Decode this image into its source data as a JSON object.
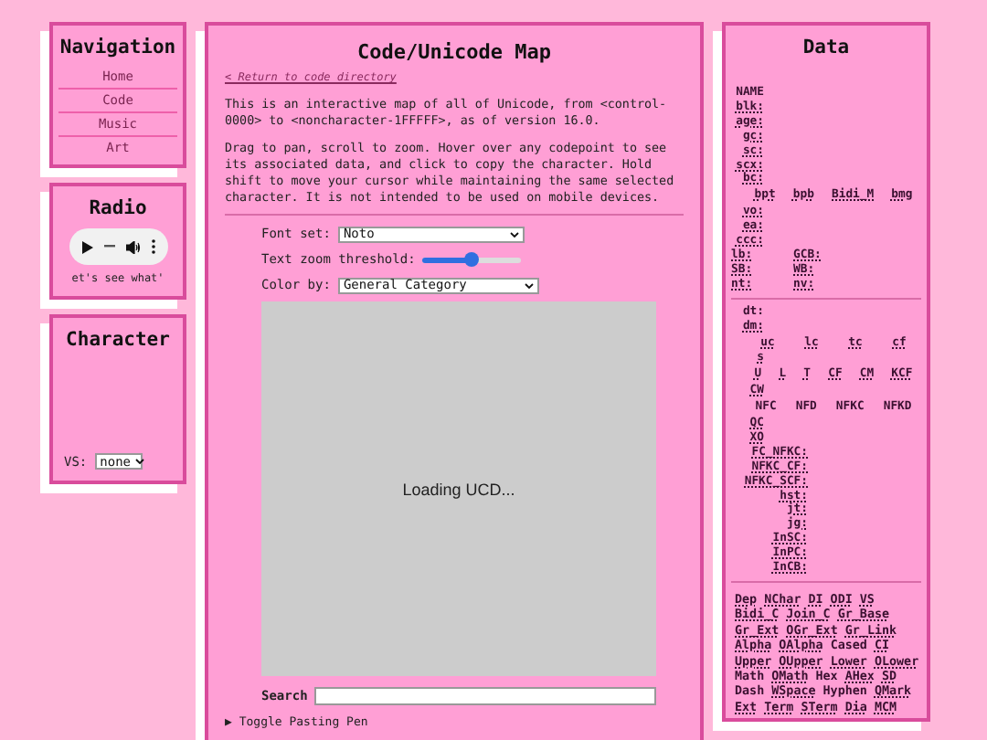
{
  "nav": {
    "title": "Navigation",
    "items": [
      {
        "label": "Home"
      },
      {
        "label": "Code"
      },
      {
        "label": "Music"
      },
      {
        "label": "Art"
      }
    ]
  },
  "radio": {
    "title": "Radio",
    "ticker": "et's see what'"
  },
  "character": {
    "title": "Character",
    "vs_label": "VS:",
    "vs_value": "none"
  },
  "main": {
    "title": "Code/Unicode Map",
    "back_link": "< Return to code directory",
    "paragraphs": [
      "This is an interactive map of all of Unicode, from <control-0000> to <noncharacter-1FFFFF>, as of version 16.0.",
      "Drag to pan, scroll to zoom. Hover over any codepoint to see its associated data, and click to copy the character. Hold shift to move your cursor while maintaining the same selected character. It is not intended to be used on mobile devices."
    ],
    "font_set": {
      "label": "Font set:",
      "value": "Noto"
    },
    "zoom": {
      "label": "Text zoom threshold:",
      "level": 0.5
    },
    "color_by": {
      "label": "Color by:",
      "value": "General Category"
    },
    "canvas_message": "Loading UCD...",
    "search": {
      "label": "Search"
    },
    "toggle": "▶ Toggle Pasting Pen"
  },
  "data": {
    "title": "Data",
    "rows": [
      {
        "kind": "field",
        "items": [
          {
            "text": "NAME",
            "abbr": false
          }
        ]
      },
      {
        "kind": "field",
        "items": [
          {
            "text": "blk:",
            "abbr": true
          }
        ]
      },
      {
        "kind": "field",
        "items": [
          {
            "text": "age:",
            "abbr": true
          }
        ]
      },
      {
        "kind": "field",
        "items": [
          {
            "text": "gc:",
            "abbr": true
          }
        ]
      },
      {
        "kind": "field",
        "items": [
          {
            "text": "sc:",
            "abbr": true
          }
        ]
      },
      {
        "kind": "field",
        "items": [
          {
            "text": "scx:",
            "abbr": true
          }
        ]
      },
      {
        "kind": "field",
        "items": [
          {
            "text": "bc:",
            "abbr": true
          }
        ]
      },
      {
        "kind": "heads",
        "items": [
          {
            "text": "bpt",
            "abbr": true
          },
          {
            "text": "bpb",
            "abbr": true
          },
          {
            "text": "Bidi_M",
            "abbr": true
          },
          {
            "text": "bmg",
            "abbr": true
          }
        ]
      },
      {
        "kind": "field",
        "items": [
          {
            "text": "vo:",
            "abbr": true
          }
        ]
      },
      {
        "kind": "field",
        "items": [
          {
            "text": "ea:",
            "abbr": true
          }
        ]
      },
      {
        "kind": "field",
        "items": [
          {
            "text": "ccc:",
            "abbr": true
          }
        ]
      },
      {
        "kind": "pair",
        "items": [
          {
            "text": "lb:",
            "abbr": true
          },
          {
            "text": "GCB:",
            "abbr": true
          }
        ]
      },
      {
        "kind": "pair",
        "items": [
          {
            "text": "SB:",
            "abbr": true
          },
          {
            "text": "WB:",
            "abbr": true
          }
        ]
      },
      {
        "kind": "pair",
        "items": [
          {
            "text": "nt:",
            "abbr": true
          },
          {
            "text": "nv:",
            "abbr": true
          }
        ]
      },
      {
        "kind": "divider",
        "items": []
      },
      {
        "kind": "field",
        "items": [
          {
            "text": "dt:",
            "abbr": false
          }
        ]
      },
      {
        "kind": "field",
        "items": [
          {
            "text": "dm:",
            "abbr": true
          }
        ]
      },
      {
        "kind": "heads",
        "items": [
          {
            "text": "uc",
            "abbr": true
          },
          {
            "text": "lc",
            "abbr": true
          },
          {
            "text": "tc",
            "abbr": true
          },
          {
            "text": "cf",
            "abbr": true
          }
        ]
      },
      {
        "kind": "field",
        "items": [
          {
            "text": "s",
            "abbr": true
          }
        ]
      },
      {
        "kind": "heads",
        "items": [
          {
            "text": "U",
            "abbr": true
          },
          {
            "text": "L",
            "abbr": true
          },
          {
            "text": "T",
            "abbr": true
          },
          {
            "text": "CF",
            "abbr": true
          },
          {
            "text": "CM",
            "abbr": true
          },
          {
            "text": "KCF",
            "abbr": true
          }
        ]
      },
      {
        "kind": "field",
        "items": [
          {
            "text": "CW",
            "abbr": true
          }
        ]
      },
      {
        "kind": "heads",
        "items": [
          {
            "text": "NFC",
            "abbr": false
          },
          {
            "text": "NFD",
            "abbr": false
          },
          {
            "text": "NFKC",
            "abbr": false
          },
          {
            "text": "NFKD",
            "abbr": false
          }
        ]
      },
      {
        "kind": "field",
        "items": [
          {
            "text": "QC",
            "abbr": true
          }
        ]
      },
      {
        "kind": "field",
        "items": [
          {
            "text": "XO",
            "abbr": true
          }
        ]
      },
      {
        "kind": "wide",
        "items": [
          {
            "text": "FC_NFKC:",
            "abbr": true
          }
        ]
      },
      {
        "kind": "wide",
        "items": [
          {
            "text": "NFKC_CF:",
            "abbr": true
          }
        ]
      },
      {
        "kind": "wide",
        "items": [
          {
            "text": "NFKC_SCF:",
            "abbr": true
          }
        ]
      },
      {
        "kind": "wide",
        "items": [
          {
            "text": "hst:",
            "abbr": true
          }
        ]
      },
      {
        "kind": "wide",
        "items": [
          {
            "text": "jt:",
            "abbr": true
          }
        ]
      },
      {
        "kind": "wide",
        "items": [
          {
            "text": "jg:",
            "abbr": true
          }
        ]
      },
      {
        "kind": "wide",
        "items": [
          {
            "text": "InSC:",
            "abbr": true
          }
        ]
      },
      {
        "kind": "wide",
        "items": [
          {
            "text": "InPC:",
            "abbr": true
          }
        ]
      },
      {
        "kind": "wide",
        "items": [
          {
            "text": "InCB:",
            "abbr": true
          }
        ]
      },
      {
        "kind": "divider",
        "items": []
      }
    ],
    "flag_lines": [
      [
        {
          "text": "Dep",
          "abbr": true
        },
        {
          "text": "NChar",
          "abbr": true
        },
        {
          "text": "DI",
          "abbr": true
        },
        {
          "text": "ODI",
          "abbr": true
        },
        {
          "text": "VS",
          "abbr": true
        }
      ],
      [
        {
          "text": "Bidi_C",
          "abbr": true
        },
        {
          "text": "Join_C",
          "abbr": true
        },
        {
          "text": "Gr_Base",
          "abbr": true
        }
      ],
      [
        {
          "text": "Gr_Ext",
          "abbr": true
        },
        {
          "text": "OGr_Ext",
          "abbr": true
        },
        {
          "text": "Gr_Link",
          "abbr": true
        }
      ],
      [
        {
          "text": "Alpha",
          "abbr": true
        },
        {
          "text": "OAlpha",
          "abbr": true
        },
        {
          "text": "Cased",
          "abbr": false
        },
        {
          "text": "CI",
          "abbr": true
        }
      ],
      [
        {
          "text": "Upper",
          "abbr": true
        },
        {
          "text": "OUpper",
          "abbr": true
        },
        {
          "text": "Lower",
          "abbr": true
        },
        {
          "text": "OLower",
          "abbr": true
        }
      ],
      [
        {
          "text": "Math",
          "abbr": false
        },
        {
          "text": "OMath",
          "abbr": true
        },
        {
          "text": "Hex",
          "abbr": false
        },
        {
          "text": "AHex",
          "abbr": true
        },
        {
          "text": "SD",
          "abbr": true
        }
      ],
      [
        {
          "text": "Dash",
          "abbr": false
        },
        {
          "text": "WSpace",
          "abbr": true
        },
        {
          "text": "Hyphen",
          "abbr": false
        },
        {
          "text": "QMark",
          "abbr": true
        }
      ],
      [
        {
          "text": "Ext",
          "abbr": true
        },
        {
          "text": "Term",
          "abbr": true
        },
        {
          "text": "STerm",
          "abbr": true
        },
        {
          "text": "Dia",
          "abbr": true
        },
        {
          "text": "MCM",
          "abbr": true
        }
      ]
    ]
  }
}
